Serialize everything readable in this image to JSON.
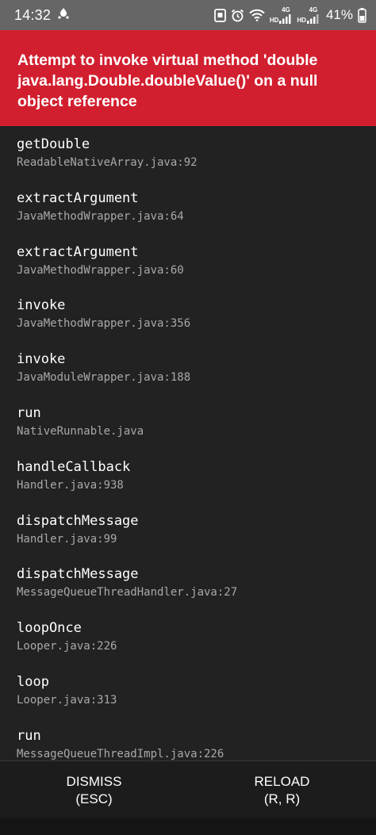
{
  "status_bar": {
    "time": "14:32",
    "net_type_1": "HD",
    "net_gen_1": "4G",
    "net_type_2": "HD",
    "net_gen_2": "4G",
    "battery": "41%",
    "icons": [
      "notification-app-icon",
      "screenshot-icon",
      "alarm-icon",
      "wifi-icon",
      "signal-icon",
      "signal-icon",
      "battery-icon"
    ]
  },
  "error": {
    "message": "Attempt to invoke virtual method 'double java.lang.Double.doubleValue()' on a null object reference",
    "background": "#d21f2f"
  },
  "stack": [
    {
      "method": "getDouble",
      "file": "ReadableNativeArray.java:92"
    },
    {
      "method": "extractArgument",
      "file": "JavaMethodWrapper.java:64"
    },
    {
      "method": "extractArgument",
      "file": "JavaMethodWrapper.java:60"
    },
    {
      "method": "invoke",
      "file": "JavaMethodWrapper.java:356"
    },
    {
      "method": "invoke",
      "file": "JavaModuleWrapper.java:188"
    },
    {
      "method": "run",
      "file": "NativeRunnable.java"
    },
    {
      "method": "handleCallback",
      "file": "Handler.java:938"
    },
    {
      "method": "dispatchMessage",
      "file": "Handler.java:99"
    },
    {
      "method": "dispatchMessage",
      "file": "MessageQueueThreadHandler.java:27"
    },
    {
      "method": "loopOnce",
      "file": "Looper.java:226"
    },
    {
      "method": "loop",
      "file": "Looper.java:313"
    },
    {
      "method": "run",
      "file": "MessageQueueThreadImpl.java:226"
    }
  ],
  "actions": {
    "dismiss_label": "DISMISS",
    "dismiss_shortcut": "(ESC)",
    "reload_label": "RELOAD",
    "reload_shortcut": "(R, R)"
  }
}
